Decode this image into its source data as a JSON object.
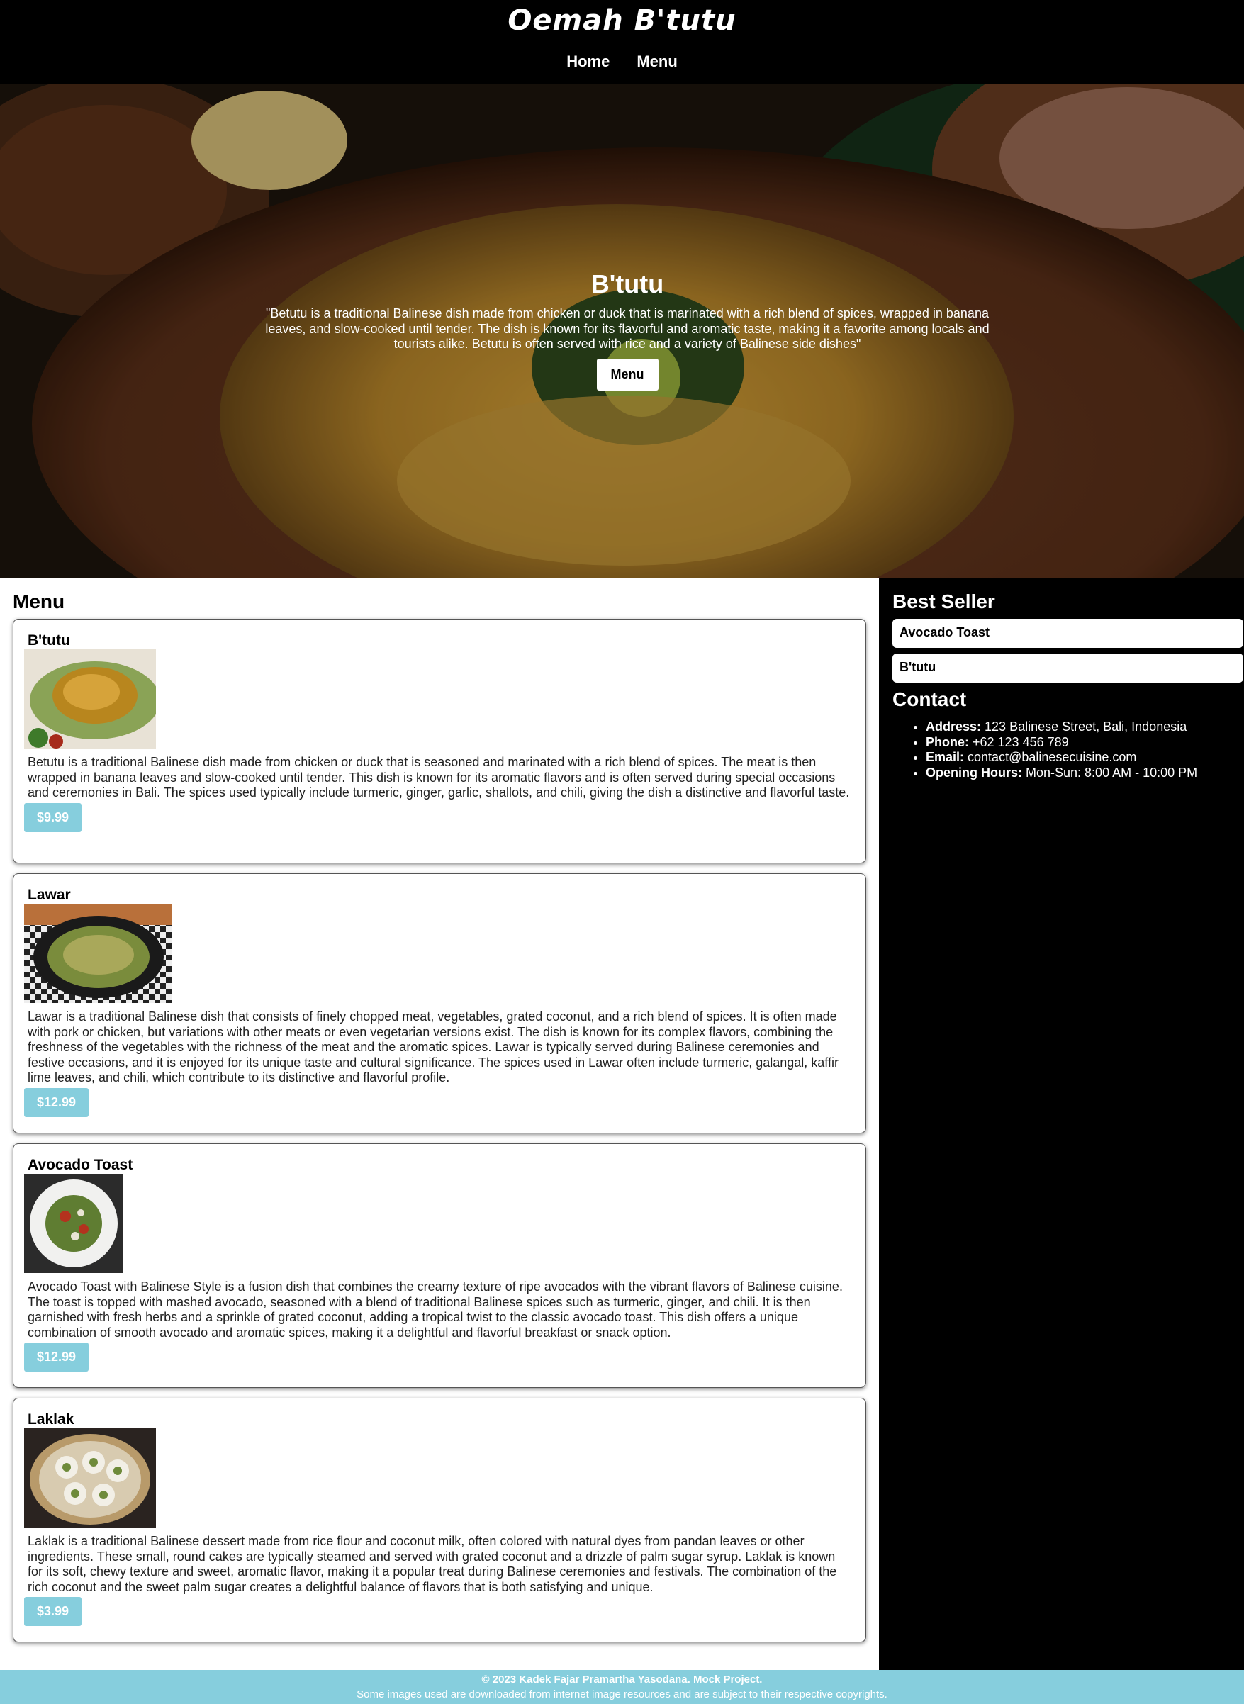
{
  "header": {
    "logo": "Oemah B'tutu",
    "nav": [
      "Home",
      "Menu"
    ]
  },
  "hero": {
    "title": "B'tutu",
    "text": "\"Betutu is a traditional Balinese dish made from chicken or duck that is marinated with a rich blend of spices, wrapped in banana leaves, and slow-cooked until tender. The dish is known for its flavorful and aromatic taste, making it a favorite among locals and tourists alike. Betutu is often served with rice and a variety of Balinese side dishes\"",
    "button": "Menu"
  },
  "menu": {
    "title": "Menu",
    "items": [
      {
        "name": "B'tutu",
        "description": "Betutu is a traditional Balinese dish made from chicken or duck that is seasoned and marinated with a rich blend of spices. The meat is then wrapped in banana leaves and slow-cooked until tender. This dish is known for its aromatic flavors and is often served during special occasions and ceremonies in Bali. The spices used typically include turmeric, ginger, garlic, shallots, and chili, giving the dish a distinctive and flavorful taste.",
        "price": "$9.99"
      },
      {
        "name": "Lawar",
        "description": "Lawar is a traditional Balinese dish that consists of finely chopped meat, vegetables, grated coconut, and a rich blend of spices. It is often made with pork or chicken, but variations with other meats or even vegetarian versions exist. The dish is known for its complex flavors, combining the freshness of the vegetables with the richness of the meat and the aromatic spices. Lawar is typically served during Balinese ceremonies and festive occasions, and it is enjoyed for its unique taste and cultural significance. The spices used in Lawar often include turmeric, galangal, kaffir lime leaves, and chili, which contribute to its distinctive and flavorful profile.",
        "price": "$12.99"
      },
      {
        "name": "Avocado Toast",
        "description": "Avocado Toast with Balinese Style is a fusion dish that combines the creamy texture of ripe avocados with the vibrant flavors of Balinese cuisine. The toast is topped with mashed avocado, seasoned with a blend of traditional Balinese spices such as turmeric, ginger, and chili. It is then garnished with fresh herbs and a sprinkle of grated coconut, adding a tropical twist to the classic avocado toast. This dish offers a unique combination of smooth avocado and aromatic spices, making it a delightful and flavorful breakfast or snack option.",
        "price": "$12.99"
      },
      {
        "name": "Laklak",
        "description": "Laklak is a traditional Balinese dessert made from rice flour and coconut milk, often colored with natural dyes from pandan leaves or other ingredients. These small, round cakes are typically steamed and served with grated coconut and a drizzle of palm sugar syrup. Laklak is known for its soft, chewy texture and sweet, aromatic flavor, making it a popular treat during Balinese ceremonies and festivals. The combination of the rich coconut and the sweet palm sugar creates a delightful balance of flavors that is both satisfying and unique.",
        "price": "$3.99"
      }
    ]
  },
  "sidebar": {
    "best_seller_title": "Best Seller",
    "best_sellers": [
      "Avocado Toast",
      "B'tutu"
    ],
    "contact_title": "Contact",
    "contact": [
      {
        "label": "Address:",
        "value": " 123 Balinese Street, Bali, Indonesia"
      },
      {
        "label": "Phone:",
        "value": " +62 123 456 789"
      },
      {
        "label": "Email:",
        "value": " contact@balinesecuisine.com"
      },
      {
        "label": "Opening Hours:",
        "value": " Mon-Sun: 8:00 AM - 10:00 PM"
      }
    ]
  },
  "footer": {
    "line1": "© 2023 Kadek Fajar Pramartha Yasodana. Mock Project.",
    "line2": "Some images used are downloaded from internet image resources and are subject to their respective copyrights."
  },
  "colors": {
    "header_bg": "#000000",
    "accent": "#86cedd",
    "sidebar_bg": "#000000"
  }
}
